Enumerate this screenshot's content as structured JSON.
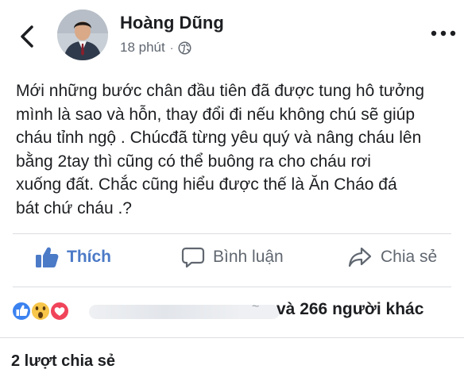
{
  "post": {
    "author": "Hoàng Dũng",
    "time": "18 phút",
    "separator": "·",
    "privacy_icon": "globe-icon",
    "text": "Mới những bước chân đầu tiên đã được tung hô tưởng\nmình là sao và hỗn, thay đổi đi nếu không chú sẽ giúp\ncháu tỉnh ngộ . Chúcđã từng yêu quý và nâng cháu lên\nbằng 2tay thì cũng có thể buông ra cho cháu rơi\nxuống đất. Chắc cũng hiểu được thế là Ăn Cháo đá\nbát chứ cháu .?"
  },
  "actions": {
    "like": "Thích",
    "comment": "Bình luận",
    "share": "Chia sẻ"
  },
  "reactions": {
    "icons": [
      "like-reaction-icon",
      "wow-reaction-icon",
      "love-reaction-icon"
    ],
    "others": "và 266 người khác"
  },
  "shares": "2 lượt chia sẻ",
  "colors": {
    "like_blue": "#4b7ac7",
    "text": "#1c1e21",
    "secondary": "#606770",
    "divider": "#dadde1"
  }
}
